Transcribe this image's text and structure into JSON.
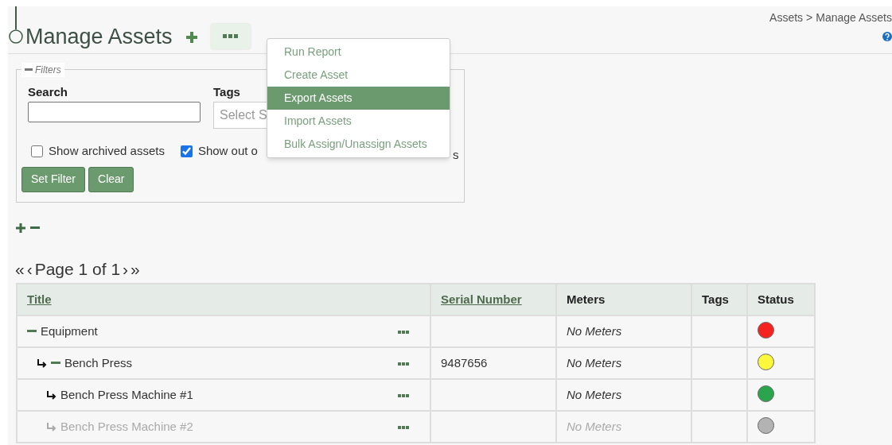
{
  "breadcrumb": {
    "parent": "Assets",
    "separator": ">",
    "current": "Manage Assets"
  },
  "page_title": "Manage Assets",
  "actions_menu": {
    "expanded": true,
    "items": [
      {
        "label": "Run Report",
        "selected": false
      },
      {
        "label": "Create Asset",
        "selected": false
      },
      {
        "label": "Export Assets",
        "selected": true
      },
      {
        "label": "Import Assets",
        "selected": false
      },
      {
        "label": "Bulk Assign/Unassign Assets",
        "selected": false
      }
    ]
  },
  "filters": {
    "legend": "Filters",
    "expanded": true,
    "search": {
      "label": "Search"
    },
    "tags": {
      "label": "Tags",
      "placeholder": "Select S"
    },
    "checkboxes": [
      {
        "label": "Show archived assets",
        "checked": false
      },
      {
        "label": "Show out o",
        "checked": true,
        "tail": "s"
      }
    ],
    "buttons": [
      "Set Filter",
      "Clear"
    ]
  },
  "pagination": {
    "first": "«",
    "prev": "‹",
    "label": "Page 1 of 1",
    "next": "›",
    "last": "»"
  },
  "table": {
    "columns": [
      {
        "label": "Title",
        "sortable": true
      },
      {
        "label": "Serial Number",
        "sortable": true
      },
      {
        "label": "Meters",
        "sortable": false
      },
      {
        "label": "Tags",
        "sortable": false
      },
      {
        "label": "Status",
        "sortable": false
      }
    ],
    "rows": [
      {
        "title": "Equipment",
        "expanded": true,
        "disabled": false,
        "serial": "",
        "meters": "No Meters",
        "color": "#f5231f",
        "children": [
          {
            "title": "Bench Press",
            "expanded": true,
            "disabled": false,
            "serial": "9487656",
            "meters": "No Meters",
            "color": "#fbf73a",
            "children": [
              {
                "title": "Bench Press Machine #1",
                "disabled": false,
                "meters": "No Meters",
                "color": "#2aa54e"
              },
              {
                "title": "Bench Press Machine #2",
                "disabled": true,
                "meters": "No Meters",
                "color": "#b3b3b3"
              }
            ]
          }
        ]
      }
    ]
  }
}
